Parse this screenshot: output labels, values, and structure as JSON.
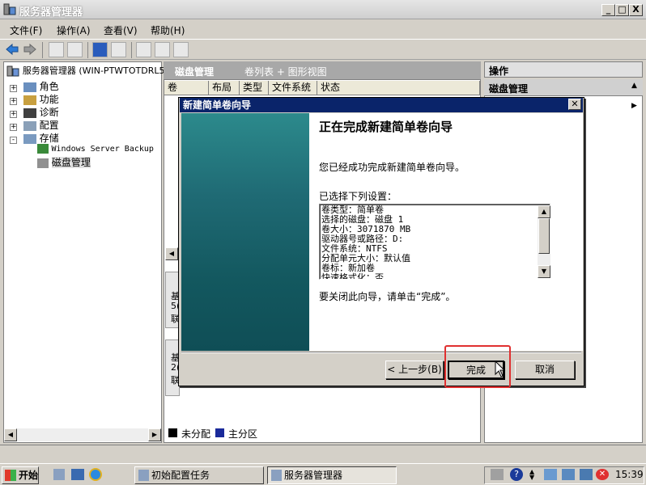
{
  "window": {
    "title": "服务器管理器",
    "min": "_",
    "max": "□",
    "close": "X"
  },
  "menu": [
    "文件(F)",
    "操作(A)",
    "查看(V)",
    "帮助(H)"
  ],
  "tree": {
    "root": "服务器管理器 (WIN-PTWTOTDRL5",
    "items": [
      "角色",
      "功能",
      "诊断",
      "配置",
      "存储"
    ],
    "storage_children": [
      "Windows Server Backup",
      "磁盘管理"
    ]
  },
  "middle": {
    "title": "磁盘管理",
    "subtitle": "卷列表 + 图形视图",
    "columns": [
      "卷",
      "布局",
      "类型",
      "文件系统",
      "状态"
    ],
    "disk_labels": [
      "基",
      "5(",
      "联",
      "基",
      "2(",
      "联"
    ],
    "legend": [
      "未分配",
      "主分区"
    ]
  },
  "actions": {
    "title": "操作",
    "subtitle": "磁盘管理"
  },
  "dialog": {
    "title": "新建简单卷向导",
    "heading": "正在完成新建简单卷向导",
    "intro": "您已经成功完成新建简单卷向导。",
    "settings_label": "已选择下列设置：",
    "settings": [
      "卷类型：简单卷",
      "选择的磁盘：磁盘 1",
      "卷大小：3071870 MB",
      "驱动器号或路径：D:",
      "文件系统：NTFS",
      "分配单元大小：默认值",
      "卷标：新加卷",
      "快速格式化：否"
    ],
    "closing": "要关闭此向导，请单击“完成”。",
    "buttons": {
      "back": "< 上一步(B)",
      "finish": "完成",
      "cancel": "取消"
    }
  },
  "taskbar": {
    "start": "开始",
    "tasks": [
      "初始配置任务",
      "服务器管理器"
    ],
    "clock": "15:39"
  }
}
